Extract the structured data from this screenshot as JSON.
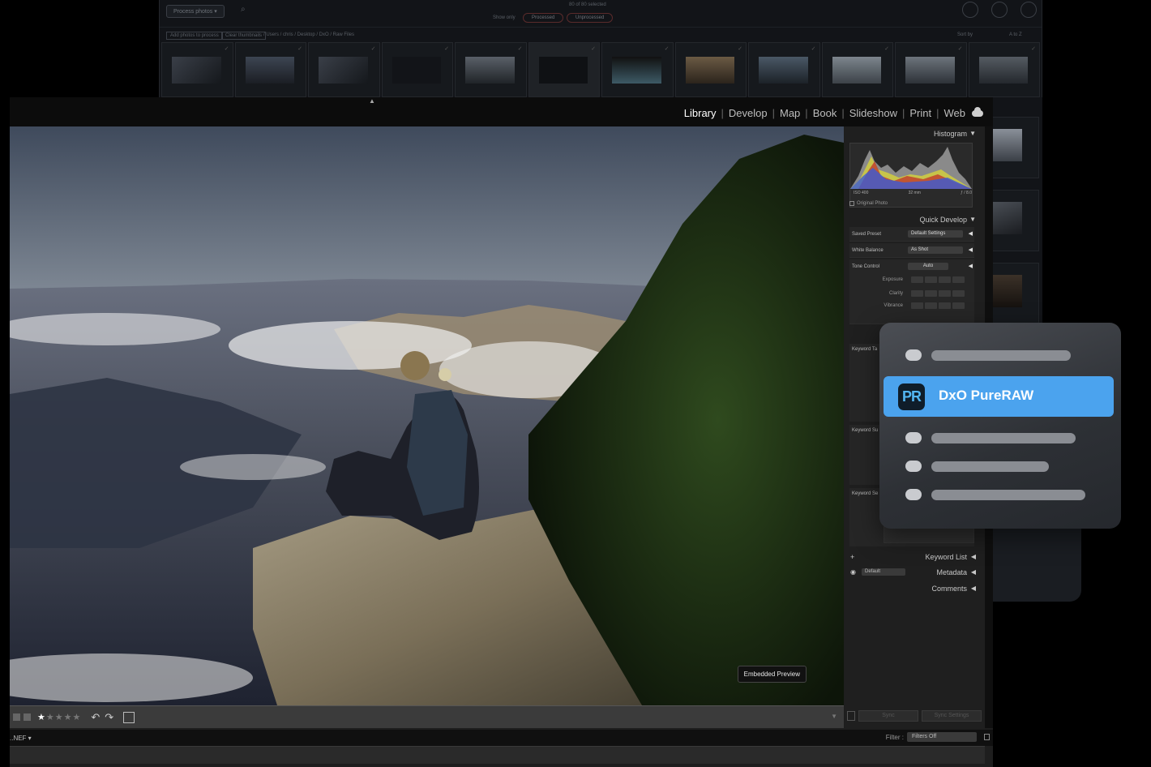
{
  "background_window": {
    "process_button": "Process photos ▾",
    "count_text": "80 of 80 selected",
    "show_only_label": "Show only",
    "filter_processed": "Processed",
    "filter_unprocessed": "Unprocessed",
    "add_photos_button": "Add photos to process",
    "clear_thumbnails_button": "Clear thumbnails",
    "path": "/ Users / chris / Desktop / DxO / Raw Files",
    "sort_label": "Sort by",
    "sort_value": "A to Z"
  },
  "lightroom": {
    "modules": [
      "Library",
      "Develop",
      "Map",
      "Book",
      "Slideshow",
      "Print",
      "Web"
    ],
    "active_module": "Library",
    "embedded_preview_badge": "Embedded Preview",
    "rating_on": "★",
    "rating_off": "★★★★",
    "filename": "..NEF ▾",
    "filter_label": "Filter :",
    "filter_value": "Filters Off",
    "right_panel": {
      "histogram_title": "Histogram",
      "iso": "ISO 400",
      "focal": "32 mm",
      "aperture": "ƒ / 8.0",
      "original_photo": "Original Photo",
      "quick_develop_title": "Quick Develop",
      "saved_preset_label": "Saved Preset",
      "saved_preset_value": "Default Settings",
      "white_balance_label": "White Balance",
      "white_balance_value": "As Shot",
      "tone_control_label": "Tone Control",
      "tone_control_value": "Auto",
      "exposure_label": "Exposure",
      "clarity_label": "Clarity",
      "vibrance_label": "Vibrance",
      "keyword_tags_label": "Keyword Ta",
      "keyword_suggestions_label": "Keyword Su",
      "keyword_set_label": "Keyword Se",
      "keyword_list_title": "Keyword List",
      "metadata_title": "Metadata",
      "metadata_preset": "Default",
      "comments_title": "Comments",
      "sync_button": "Sync",
      "sync_settings_button": "Sync Settings"
    }
  },
  "context_menu": {
    "highlighted_item": "DxO PureRAW",
    "logo_text": "PR",
    "accent_color": "#4ba3ee"
  }
}
